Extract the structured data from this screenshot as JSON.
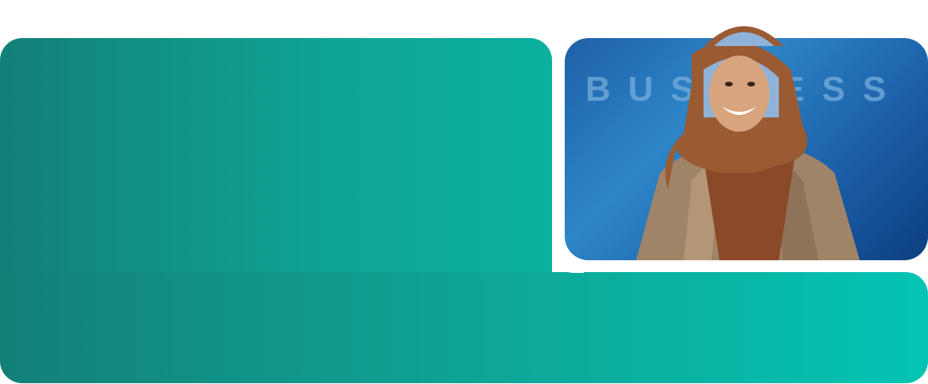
{
  "card": {
    "background_word": "BUSINESS"
  },
  "colors": {
    "teal_start": "#138078",
    "teal_end": "#03c4b4",
    "card_blue": "#2d86c8",
    "card_blue_dark": "#0c3f80",
    "text_watermark": "#6ea6d8"
  },
  "image": {
    "subject": "smiling-woman-hijab-photo"
  }
}
